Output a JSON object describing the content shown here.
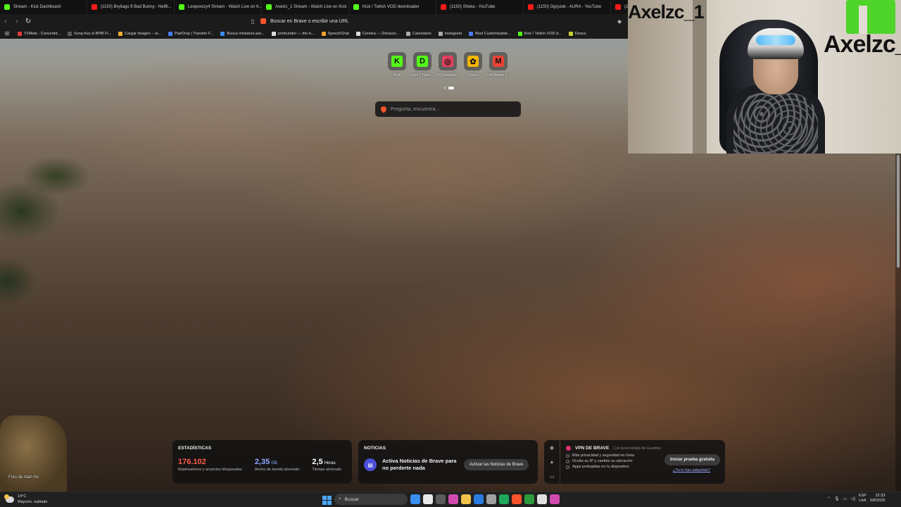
{
  "browser": {
    "tabs": [
      {
        "label": "Stream - Kick Dashboard",
        "icon": "kick"
      },
      {
        "label": "(1150) Brytiago ft Bad Bunny - Netfli...",
        "icon": "yt"
      },
      {
        "label": "Leoperezy4 Stream - Watch Live on K...",
        "icon": "kick"
      },
      {
        "label": "Axelzc_1 Stream - Watch Live on Kick",
        "icon": "kick"
      },
      {
        "label": "Kick / Twitch VOD downloader",
        "icon": "kick"
      },
      {
        "label": "(1150) Shoka - YouTube",
        "icon": "yt"
      },
      {
        "label": "(1150) Ogryzek - AURA - YouTube",
        "icon": "yt"
      },
      {
        "label": "(115",
        "icon": "yt"
      }
    ],
    "address_placeholder": "Buscar en Brave o escribir una URL",
    "bookmarks": [
      {
        "label": "Y2Mate - Convertid...",
        "color": "#e23b3b"
      },
      {
        "label": "Song Key & BPM Fi...",
        "color": "#5a5a5a"
      },
      {
        "label": "Cargar imagen – re...",
        "color": "#f0b030"
      },
      {
        "label": "PairDrop | Transfer F...",
        "color": "#4a7cf0"
      },
      {
        "label": "Busca miniatura par...",
        "color": "#3a8ef0"
      },
      {
        "label": "profounder — the b...",
        "color": "#dddddd"
      },
      {
        "label": "SpeechChat",
        "color": "#f0a030"
      },
      {
        "label": "Ceneka — Donacio...",
        "color": "#dddddd"
      },
      {
        "label": "Calendario",
        "color": "#aaaaaa"
      },
      {
        "label": "Instagram",
        "color": "#aaaaaa"
      },
      {
        "label": "Best Customizable...",
        "color": "#4a7cf0"
      },
      {
        "label": "Kick / Twitch VOD d...",
        "color": "#53fc18"
      },
      {
        "label": "Desca",
        "color": "#c8d030"
      }
    ]
  },
  "new_tab": {
    "top_sites": [
      {
        "label": "Kick",
        "glyph": "K",
        "color": "#53fc18"
      },
      {
        "label": "Kick / Twitc...",
        "glyph": "D",
        "color": "#53fc18"
      },
      {
        "label": "(8) Instagra...",
        "glyph": "◎",
        "color": "#e4405f"
      },
      {
        "label": "Fotos",
        "glyph": "✿",
        "color": "#f4b400"
      },
      {
        "label": "Recibidos (...",
        "glyph": "M",
        "color": "#ea4335"
      }
    ],
    "search_placeholder": "Pregunta, encuentra...",
    "photo_credit": "Foto de Alan Hu"
  },
  "stats": {
    "title": "ESTADÍSTICAS",
    "items": [
      {
        "value": "176.102",
        "unit": "",
        "caption": "Rastreadores y anuncios bloqueados",
        "color": "#ff5a4a"
      },
      {
        "value": "2,35",
        "unit": "GB",
        "caption": "Ancho de banda ahorrado",
        "color": "#8ea8ff"
      },
      {
        "value": "2,5",
        "unit": "Horas",
        "caption": "Tiempo ahorrado",
        "color": "#ffffff"
      }
    ]
  },
  "news": {
    "title": "NOTICIAS",
    "text": "Activa Noticias de Brave para no perderte nada",
    "button": "Activar las Noticias de Brave"
  },
  "vpn": {
    "title": "VPN DE BRAVE",
    "subtitle": "Con la tecnología de  Guardian",
    "features": [
      "Más privacidad y seguridad en línea",
      "Oculte su IP y cambie su ubicación",
      "Apps protegidas en tu dispositivo"
    ],
    "button": "Iniciar prueba gratuita",
    "link": "¿Ya lo has adquirido?"
  },
  "webcam": {
    "name_left": "Axelzc_1",
    "name_right": "Axelzc_"
  },
  "taskbar": {
    "temp": "14°C",
    "weather": "Mayorm. nublado",
    "search": "Buscar",
    "lang_top": "ESP",
    "lang_bottom": "LAA",
    "time": "22:33",
    "date": "5/8/2026",
    "apps": [
      "#3a8ef0",
      "#e8e8e8",
      "#5a5a5a",
      "#d04ab0",
      "#f0c24a",
      "#2a7ae0",
      "#a0a0a0",
      "#1fa85a",
      "#fb542b",
      "#2c9a3a",
      "#e0e0e0",
      "#d04ab0"
    ]
  }
}
